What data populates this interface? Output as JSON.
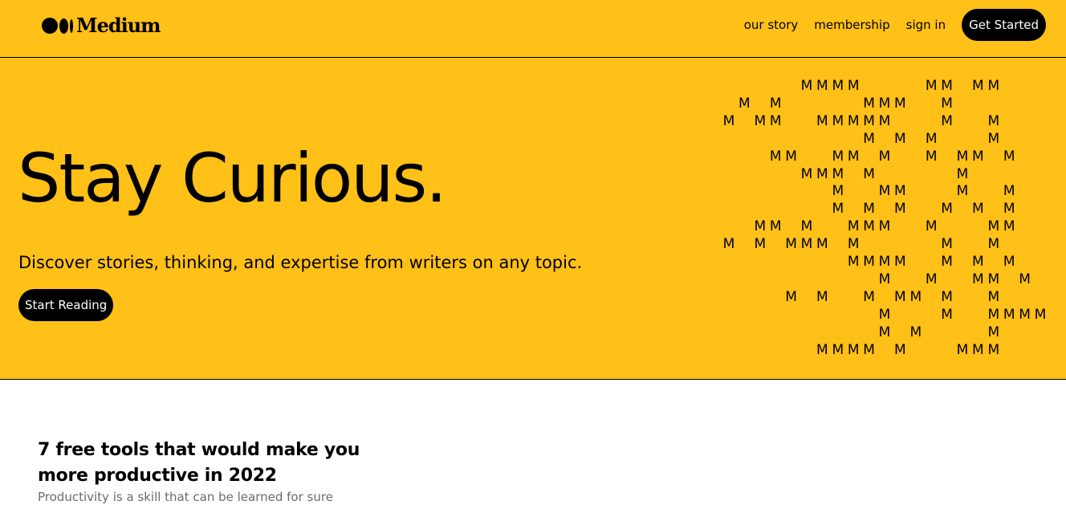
{
  "brand": {
    "logo_text": "Medium",
    "accent_color": "#FFC017"
  },
  "nav": {
    "links": [
      "our story",
      "membership",
      "sign in"
    ],
    "cta_label": "Get Started"
  },
  "hero": {
    "title": "Stay Curious.",
    "subtitle": "Discover stories, thinking, and expertise from writers on any topic.",
    "cta_label": "Start Reading",
    "m_glyph": "M",
    "m_pattern": [
      "     MMMM    MM MM",
      " M M     MMM  M   ",
      "M MM  MMMMM   M  M",
      "         M M M   M",
      "   MM  MM M  M MM M",
      "     MMM M     M  ",
      "       M  MM   M  M",
      "       M M M  M M M",
      "  MM M  MMM  M   MM",
      "M M MMM M     M  M",
      "        MMMM  M M M",
      "          M  M  MM M",
      "    M M  M MM M  M",
      "          M   M  MMMM",
      "          M M    M",
      "      MMMM M   MMM"
    ]
  },
  "article": {
    "title": "7 free tools that would make you more productive in 2022",
    "subtitle": "Productivity is a skill that can be learned for sure"
  }
}
